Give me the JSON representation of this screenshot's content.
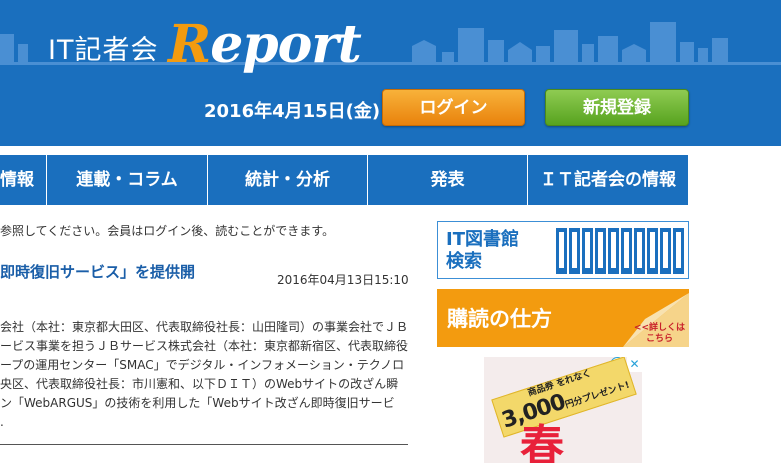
{
  "header": {
    "logo_kanji": "IT記者会",
    "logo_report_first": "R",
    "logo_report_rest": "eport",
    "date": "2016年4月15日(金)",
    "login_label": "ログイン",
    "register_label": "新規登録",
    "colors": {
      "bg": "#1a6fbe",
      "accent": "#f39b0f",
      "login": "#f39b0f",
      "register": "#6bb52f"
    }
  },
  "nav": {
    "items": [
      {
        "label": "情報"
      },
      {
        "label": "連載・コラム"
      },
      {
        "label": "統計・分析"
      },
      {
        "label": "発表"
      },
      {
        "label": "ＩＴ記者会の情報"
      }
    ]
  },
  "main": {
    "notice": "参照してください。会員はログイン後、読むことができます。",
    "article": {
      "title": "即時復旧サービス」を提供開",
      "date": "2016年04月13日15:10",
      "lines": [
        "会社（本社：東京都大田区、代表取締役社長：山田隆司）の事業会社でＪＢ",
        "ービス事業を担うＪＢサービス株式会社（本社：東京都新宿区、代表取締役",
        "ープの運用センター「SMAC」でデジタル・インフォメーション・テクノロ",
        "央区、代表取締役社長：市川憲和、以下ＤＩＴ）のWebサイトの改ざん瞬",
        "ン「WebARGUS」の技術を利用した「Webサイト改ざん即時復旧サービ",
        "."
      ]
    }
  },
  "sidebar": {
    "library_banner": {
      "line1": "IT図書館",
      "line2": "検索"
    },
    "subscribe_banner": {
      "label": "購読の仕方",
      "more_line1": "<<詳しくは",
      "more_line2": "こちら"
    },
    "ad": {
      "small_top": "商品券",
      "small_side": "をれなく",
      "big": "3,000",
      "small_suffix": "円分プレゼント!",
      "big_char": "春",
      "info_icon": "i",
      "close_icon": "✕"
    }
  }
}
